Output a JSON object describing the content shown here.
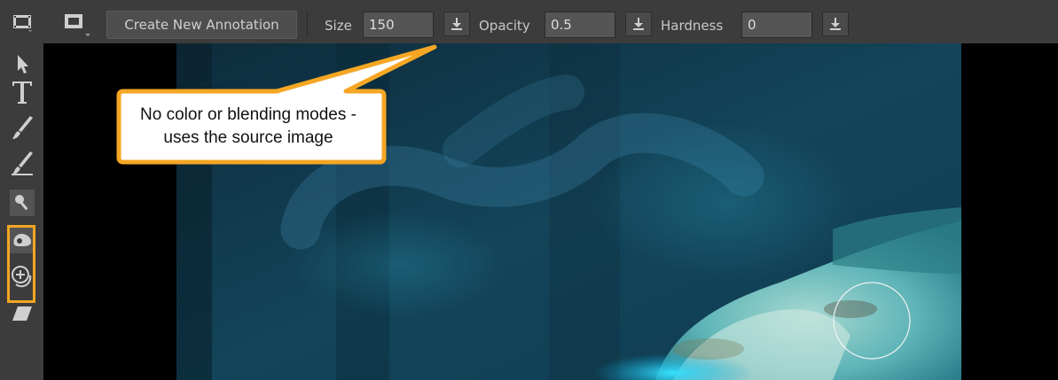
{
  "toolbar": {
    "create_label": "Create New Annotation",
    "size_label": "Size",
    "size_value": "150",
    "opacity_label": "Opacity",
    "opacity_value": "0.5",
    "hardness_label": "Hardness",
    "hardness_value": "0"
  },
  "callout": {
    "line1": "No color or blending modes -",
    "line2": "uses the source image"
  },
  "colors": {
    "panel": "#3c3c3c",
    "highlight": "#f5a623",
    "canvas": "#000000"
  }
}
